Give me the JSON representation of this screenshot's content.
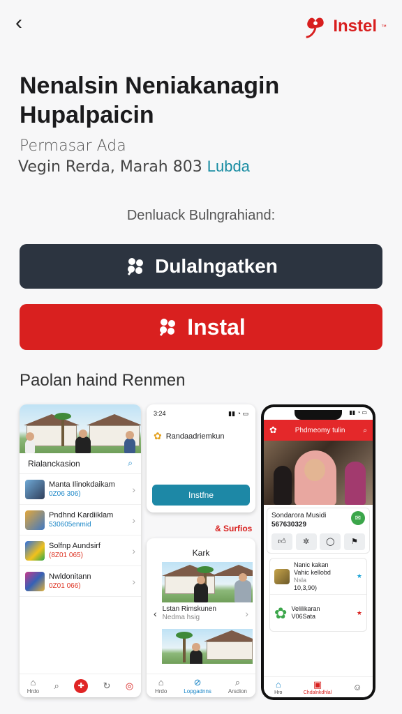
{
  "header": {
    "brand": "Instel",
    "brand_mark": "™"
  },
  "app": {
    "title": "Nenalsin Neniakanagin Hupalpaicin",
    "developer": "Permasar Ada",
    "meta": "Vegin Rerda, Marah 803",
    "meta_link": "Lubda"
  },
  "actions": {
    "prompt": "Denluack Bulngrahiand:",
    "download_label": "Dulalngatken",
    "install_label": "Instal"
  },
  "screenshots": {
    "section_title": "Paolan haind Renmen",
    "s1": {
      "search_label": "Rialanckasion",
      "items": [
        {
          "title": "Manta Ilinokdaikam",
          "sub": "0Z06 306)"
        },
        {
          "title": "Pndhnd Kardiiklam",
          "sub": "530605enmid"
        },
        {
          "title": "Solfnp Aundsirf",
          "sub": "(8Z01 065)"
        },
        {
          "title": "Nwldonitann",
          "sub": "0Z01 066)"
        }
      ],
      "tabs": [
        "Hrdo",
        "",
        "",
        "",
        ""
      ]
    },
    "s2": {
      "time": "3:24",
      "row_label": "Randaadriemkun",
      "button": "Instfne"
    },
    "floating_label": "Surfios",
    "s3": {
      "title": "Kark",
      "row_title": "Lstan Rimskunen",
      "row_sub": "Nedma hsig",
      "tabs": [
        "Hrdo",
        "Lopgadnns",
        "Arsdion"
      ]
    },
    "phone": {
      "header_title": "Phdmeomy tulin",
      "name": "Sondarora Musidi",
      "code": "567630329",
      "items": [
        {
          "title": "Nanic kakan",
          "sub1": "Vahic kellobd",
          "sub2": "Nsla",
          "sub3": "10,3,90)"
        },
        {
          "title": "Velilikaran",
          "sub1": "V06Sata",
          "sub2": "",
          "sub3": ""
        }
      ],
      "tabs": [
        "Hro",
        "Chdalnkdhlal",
        ""
      ]
    }
  },
  "colors": {
    "brand_red": "#d9201f",
    "dark_button": "#2c3440",
    "link": "#178ca2"
  }
}
